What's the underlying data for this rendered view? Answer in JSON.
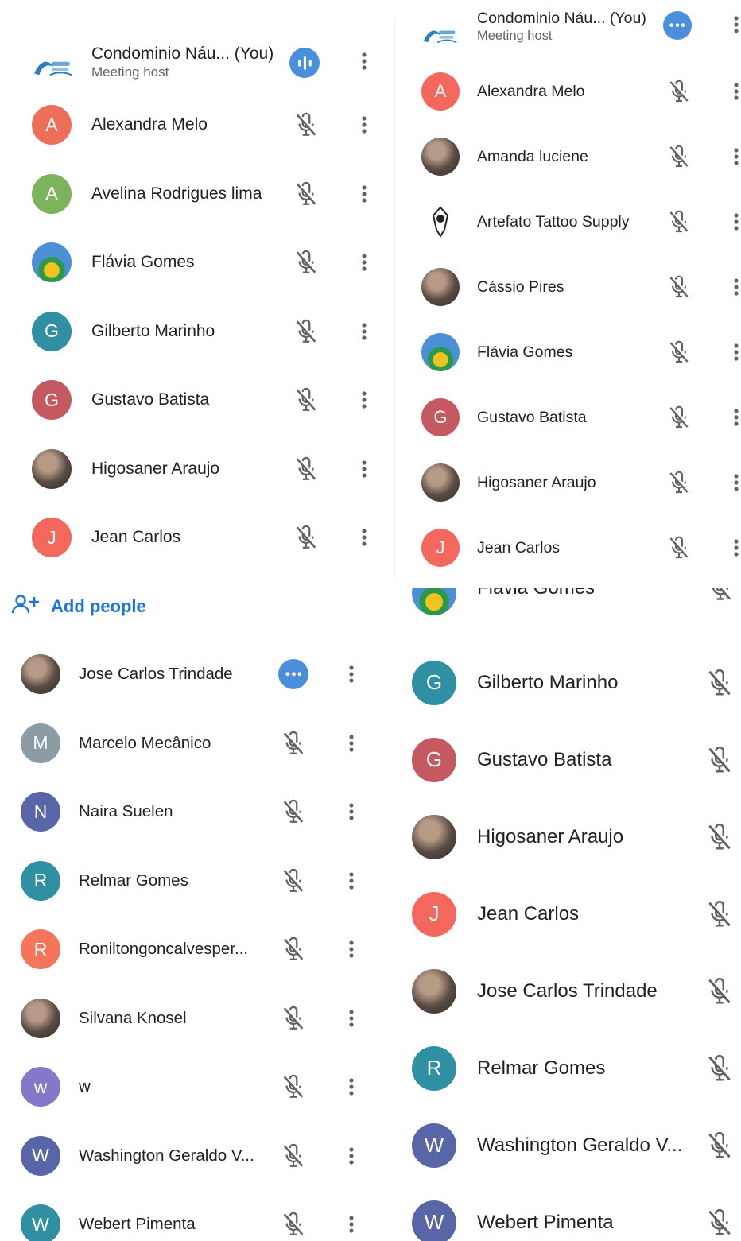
{
  "panel_top_left": {
    "host": {
      "name": "Condominio Náu... (You)",
      "role": "Meeting host"
    },
    "participants": [
      {
        "initial": "A",
        "name": "Alexandra Melo",
        "color": "#ee6f57"
      },
      {
        "initial": "A",
        "name": "Avelina Rodrigues lima",
        "color": "#7cb35c"
      },
      {
        "initial": "",
        "name": "Flávia Gomes",
        "color": ""
      },
      {
        "initial": "G",
        "name": "Gilberto Marinho",
        "color": "#2f8fa3"
      },
      {
        "initial": "G",
        "name": "Gustavo Batista",
        "color": "#c45a5f"
      },
      {
        "initial": "",
        "name": "Higosaner Araujo",
        "color": ""
      },
      {
        "initial": "J",
        "name": "Jean Carlos",
        "color": "#f4675c"
      }
    ]
  },
  "panel_top_right": {
    "host": {
      "name": "Condominio Náu... (You)",
      "role": "Meeting host"
    },
    "participants": [
      {
        "initial": "A",
        "name": "Alexandra Melo",
        "color": "#f4675c"
      },
      {
        "initial": "",
        "name": "Amanda luciene",
        "color": ""
      },
      {
        "initial": "",
        "name": "Artefato Tattoo Supply",
        "color": ""
      },
      {
        "initial": "",
        "name": "Cássio Pires",
        "color": ""
      },
      {
        "initial": "",
        "name": "Flávia Gomes",
        "color": ""
      },
      {
        "initial": "G",
        "name": "Gustavo Batista",
        "color": "#c45a5f"
      },
      {
        "initial": "",
        "name": "Higosaner Araujo",
        "color": ""
      },
      {
        "initial": "J",
        "name": "Jean Carlos",
        "color": "#f4675c"
      }
    ]
  },
  "add_people": {
    "label": "Add people"
  },
  "panel_bottom_left": {
    "participants": [
      {
        "initial": "",
        "name": "Jose Carlos Trindade",
        "color": ""
      },
      {
        "initial": "M",
        "name": "Marcelo Mecânico",
        "color": "#8d9ba5"
      },
      {
        "initial": "N",
        "name": "Naira Suelen",
        "color": "#5865a6"
      },
      {
        "initial": "R",
        "name": "Relmar Gomes",
        "color": "#2f8fa3"
      },
      {
        "initial": "R",
        "name": "Roniltongoncalvesper...",
        "color": "#f4755a"
      },
      {
        "initial": "",
        "name": "Silvana Knosel",
        "color": ""
      },
      {
        "initial": "w",
        "name": "w",
        "color": "#8478c8"
      },
      {
        "initial": "W",
        "name": "Washington Geraldo V...",
        "color": "#5865a6"
      },
      {
        "initial": "W",
        "name": "Webert Pimenta",
        "color": "#2f8fa3"
      }
    ]
  },
  "panel_bottom_right": {
    "partial_top": {
      "name": "Flávia Gomes"
    },
    "participants": [
      {
        "initial": "G",
        "name": "Gilberto Marinho",
        "color": "#2f8fa3"
      },
      {
        "initial": "G",
        "name": "Gustavo Batista",
        "color": "#c45a5f"
      },
      {
        "initial": "",
        "name": "Higosaner Araujo",
        "color": ""
      },
      {
        "initial": "J",
        "name": "Jean Carlos",
        "color": "#f4675c"
      },
      {
        "initial": "",
        "name": "Jose Carlos Trindade",
        "color": ""
      },
      {
        "initial": "R",
        "name": "Relmar Gomes",
        "color": "#2f8fa3"
      },
      {
        "initial": "W",
        "name": "Washington Geraldo V...",
        "color": "#5865a6"
      },
      {
        "initial": "W",
        "name": "Webert Pimenta",
        "color": "#5865a6"
      }
    ]
  },
  "colors": {
    "accent": "#1a73e8",
    "speaking_badge": "#4a8fdb",
    "icon": "#5f6368"
  }
}
